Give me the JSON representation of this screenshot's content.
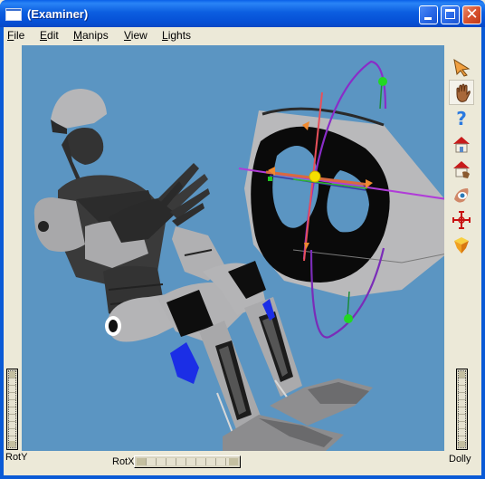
{
  "window": {
    "title": "(Examiner)",
    "controls": {
      "minimize": "minimize",
      "maximize": "maximize",
      "close": "✕"
    }
  },
  "menubar": {
    "items": [
      {
        "label": "File",
        "mnemonic": "F",
        "rest": "ile"
      },
      {
        "label": "Edit",
        "mnemonic": "E",
        "rest": "dit"
      },
      {
        "label": "Manips",
        "mnemonic": "M",
        "rest": "anips"
      },
      {
        "label": "View",
        "mnemonic": "V",
        "rest": "iew"
      },
      {
        "label": "Lights",
        "mnemonic": "L",
        "rest": "ights"
      }
    ]
  },
  "viewport": {
    "background_color": "#5b95c2",
    "scene_objects": [
      "robot-figure",
      "hollow-cylinder-object",
      "transform-manipulator"
    ]
  },
  "toolbar": {
    "tools": [
      {
        "name": "select-pointer",
        "icon": "arrow-pointer-icon",
        "active": false
      },
      {
        "name": "view-hand",
        "icon": "hand-icon",
        "active": true
      },
      {
        "name": "help",
        "icon": "question-mark-icon",
        "active": false
      },
      {
        "name": "home",
        "icon": "home-icon",
        "active": false
      },
      {
        "name": "set-home",
        "icon": "set-home-icon",
        "active": false
      },
      {
        "name": "view-all",
        "icon": "eye-icon",
        "active": false
      },
      {
        "name": "seek",
        "icon": "crosshair-icon",
        "active": false
      },
      {
        "name": "projection",
        "icon": "perspective-cube-icon",
        "active": false
      }
    ]
  },
  "thumbwheels": {
    "rot_y": {
      "label": "RotY"
    },
    "rot_x": {
      "label": "RotX"
    },
    "dolly": {
      "label": "Dolly"
    }
  }
}
